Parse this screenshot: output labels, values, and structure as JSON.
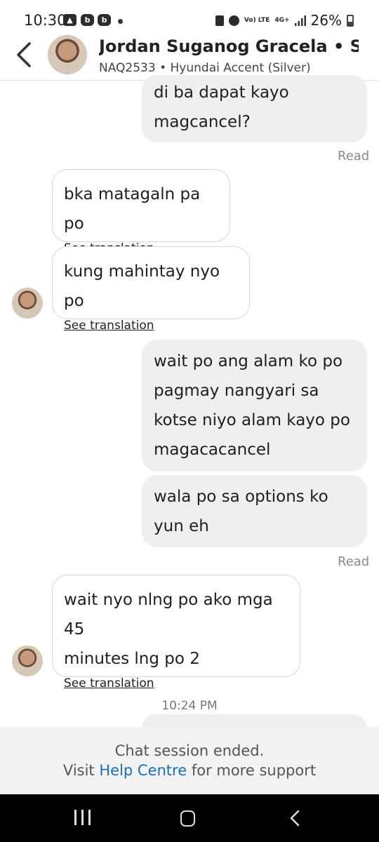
{
  "status_bar": {
    "time": "10:30",
    "left_icons": [
      "gallery-icon",
      "app-notification-icon",
      "app-notification-icon"
    ],
    "right_icons": [
      "lock-icon",
      "alarm-icon",
      "volte-icon",
      "4g-icon",
      "signal-icon"
    ],
    "volte_label": "Vo) LTE",
    "network_label": "4G+",
    "battery_percent": "26%"
  },
  "header": {
    "contact_name": "Jordan Suganog Gracela • St...",
    "vehicle_info": "NAQ2533 • Hyundai Accent (Silver)"
  },
  "messages": [
    {
      "direction": "outgoing",
      "lines": [
        "di ba dapat kayo",
        "magcancel?"
      ]
    },
    {
      "direction": "status",
      "text": "Read"
    },
    {
      "direction": "incoming",
      "lines": [
        "bka matagaln pa po"
      ],
      "link": "See translation"
    },
    {
      "direction": "incoming",
      "lines": [
        "kung mahintay nyo po"
      ],
      "link": "See translation"
    },
    {
      "direction": "outgoing",
      "lines": [
        "wait po ang alam ko po",
        "pagmay nangyari sa",
        "kotse niyo alam kayo po",
        "magacacancel"
      ]
    },
    {
      "direction": "outgoing",
      "lines": [
        "wala po sa options ko",
        "yun eh"
      ]
    },
    {
      "direction": "status",
      "text": "Read"
    },
    {
      "direction": "incoming",
      "lines": [
        "wait nyo nlng po ako mga 45",
        "minutes lng po 2"
      ],
      "link": "See translation"
    },
    {
      "direction": "timestamp",
      "text": "10:24 PM"
    }
  ],
  "footer": {
    "line1": "Chat session ended.",
    "line2_prefix": "Visit",
    "help_link": "Help Centre",
    "line2_suffix": "for more support"
  },
  "colors": {
    "link": "#1b6fb3",
    "outgoing_bubble": "#efefef",
    "footer_bg": "#f2f2f2",
    "nav_bar": "#000000"
  }
}
